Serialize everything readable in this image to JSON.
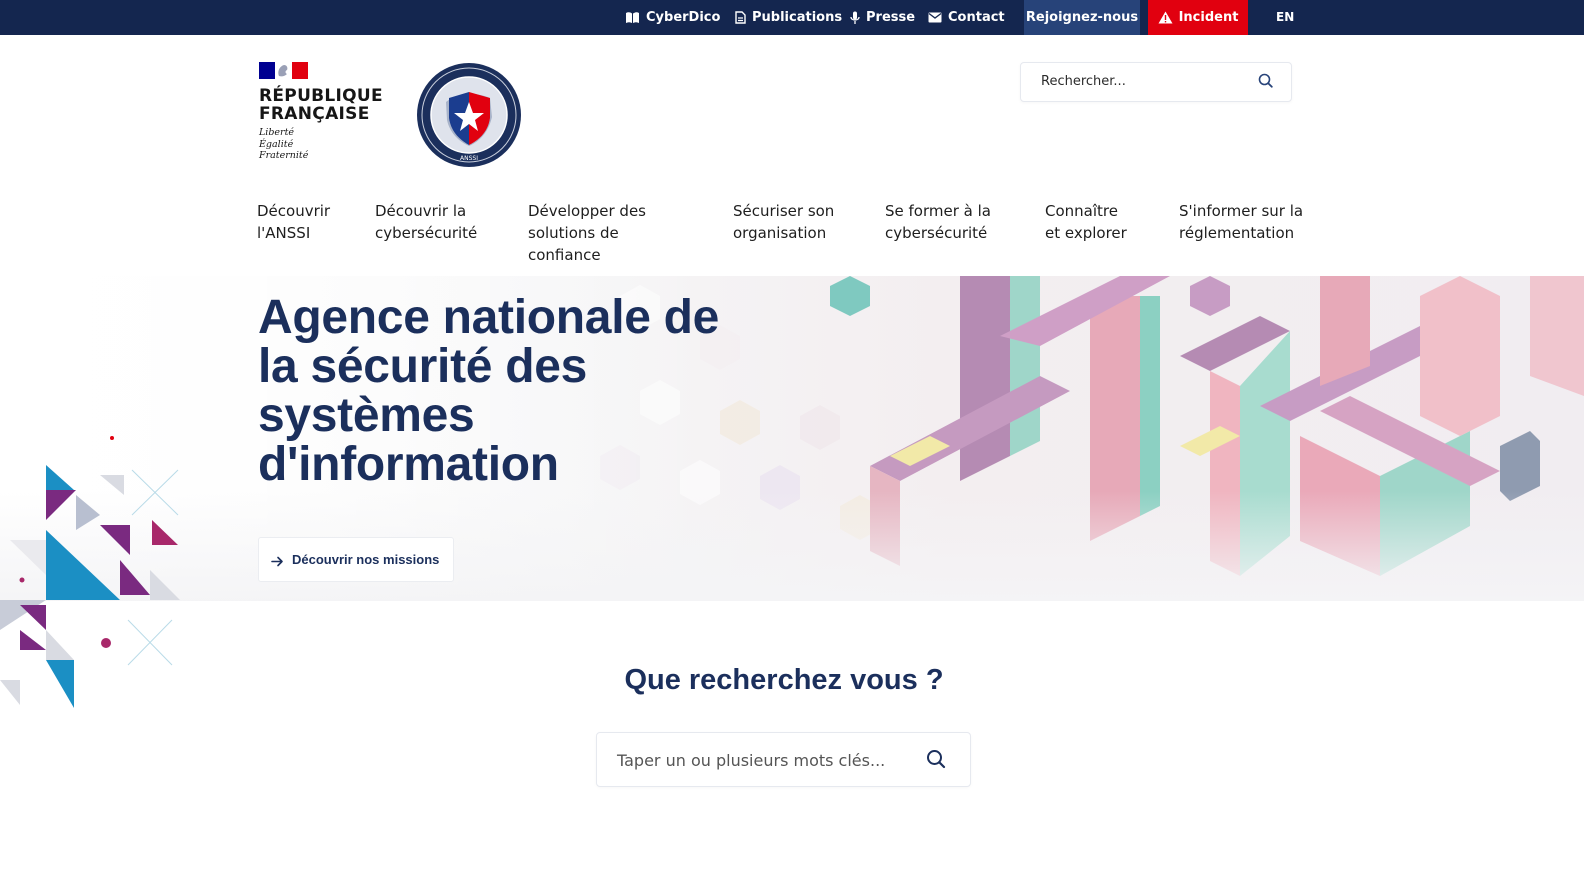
{
  "topbar": {
    "links": [
      {
        "label": "CyberDico",
        "icon": "book-icon"
      },
      {
        "label": "Publications",
        "icon": "document-icon"
      },
      {
        "label": "Presse",
        "icon": "microphone-icon"
      },
      {
        "label": "Contact",
        "icon": "envelope-icon"
      }
    ],
    "join_label": "Rejoignez-nous",
    "incident_label": "Incident",
    "lang_label": "EN"
  },
  "header": {
    "rf_name": "RÉPUBLIQUE\nFRANÇAISE",
    "rf_motto": "Liberté\nÉgalité\nFraternité",
    "seal_text": "ANSSI",
    "search_placeholder": "Rechercher..."
  },
  "nav": {
    "items": [
      {
        "label": "Découvrir\nl'ANSSI"
      },
      {
        "label": "Découvrir la\ncybersécurité"
      },
      {
        "label": "Développer des\nsolutions de\nconfiance"
      },
      {
        "label": "Sécuriser son\norganisation"
      },
      {
        "label": "Se former à la\ncybersécurité"
      },
      {
        "label": "Connaître\net explorer"
      },
      {
        "label": "S'informer sur la\nréglementation"
      }
    ]
  },
  "hero": {
    "title_lines": [
      "Agence nationale de",
      "la sécurité des",
      "systèmes",
      "d'information"
    ],
    "cta_label": "Découvrir nos missions"
  },
  "search_section": {
    "title": "Que recherchez vous ?",
    "placeholder": "Taper un ou plusieurs mots clés..."
  },
  "colors": {
    "navy": "#14264f",
    "join_bg": "#274379",
    "incident_red": "#e1000f",
    "title_blue": "#1b2f5c",
    "flag_blue": "#000091",
    "flag_red": "#e1000f"
  }
}
